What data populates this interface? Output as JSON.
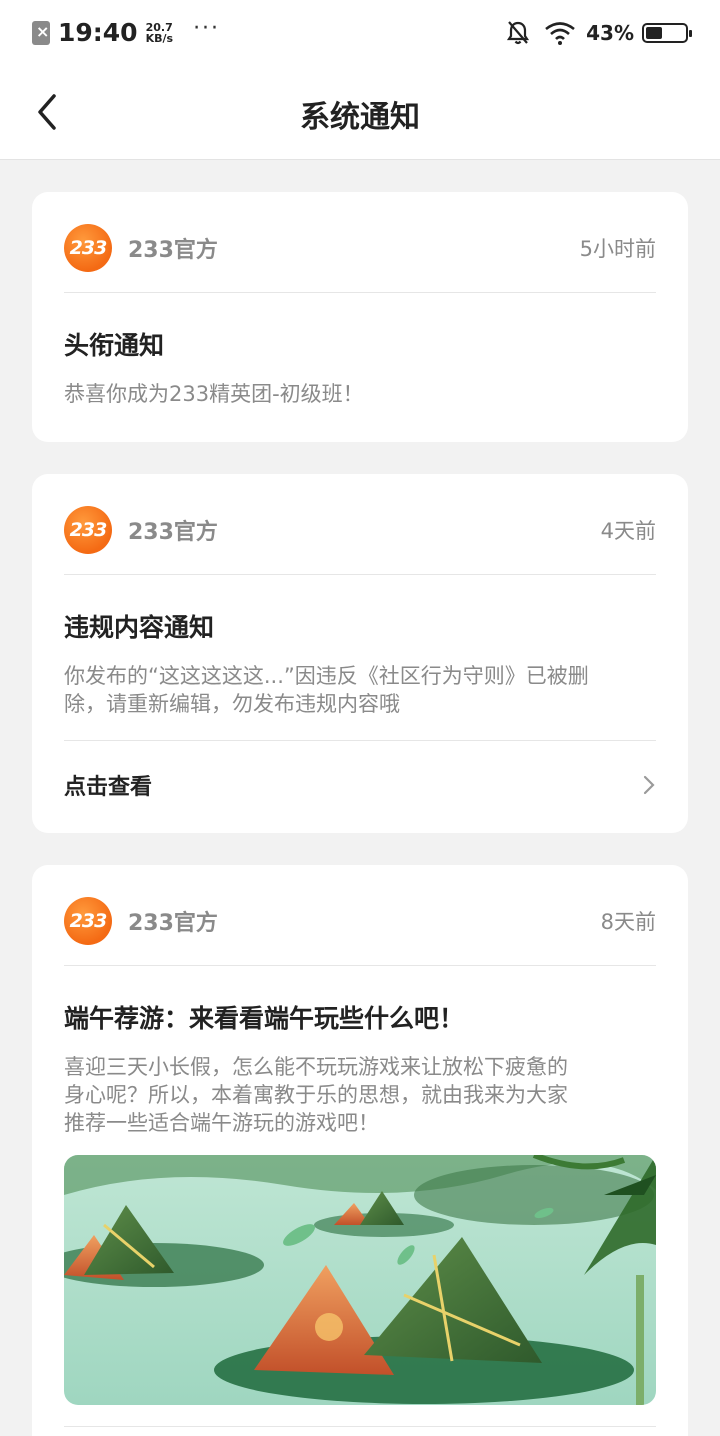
{
  "status_bar": {
    "time": "19:40",
    "net_speed_value": "20.7",
    "net_speed_unit": "KB/s",
    "more": "···",
    "battery_pct": "43%",
    "battery_level": 0.43,
    "icons": [
      "sim-icon",
      "bell-off-icon",
      "wifi-icon",
      "battery-icon"
    ]
  },
  "header": {
    "title": "系统通知"
  },
  "notifications": [
    {
      "sender": "233官方",
      "logo_text": "233",
      "time": "5小时前",
      "title": "头衔通知",
      "body": "恭喜你成为233精英团-初级班！"
    },
    {
      "sender": "233官方",
      "logo_text": "233",
      "time": "4天前",
      "title": "违规内容通知",
      "body_line1": "你发布的“这这这这这...”因违反《社区行为守则》已被删",
      "body_line2": "除，请重新编辑，勿发布违规内容哦",
      "action": "点击查看"
    },
    {
      "sender": "233官方",
      "logo_text": "233",
      "time": "8天前",
      "title": "端午荐游：来看看端午玩些什么吧！",
      "body_line1": "喜迎三天小长假，怎么能不玩玩游戏来让放松下疲惫的",
      "body_line2": "身心呢？所以，本着寓教于乐的思想，就由我来为大家",
      "body_line3": "推荐一些适合端午游玩的游戏吧！",
      "image": "dragon-boat-festival-zongzi-banner"
    }
  ],
  "colors": {
    "brand_orange": "#f46a14",
    "muted_text": "#8a8a8a",
    "background": "#f2f2f2"
  }
}
